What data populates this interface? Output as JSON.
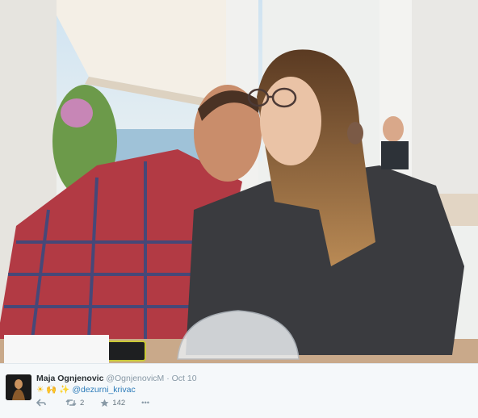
{
  "photo": {
    "alt_icon": "photo-of-couple"
  },
  "tweet": {
    "display_name": "Maja Ognjenovic",
    "handle": "@OgnjenovicM",
    "separator": "·",
    "date": "Oct 10",
    "emoji_sun": "☀",
    "emoji_hands": "🙌",
    "emoji_sparkle": "✨",
    "mention": "@dezurni_krivac",
    "retweet_count": "2",
    "favorite_count": "142",
    "more_label": "•••"
  },
  "colors": {
    "link": "#2b7bb9",
    "meta": "#8899a6",
    "text": "#292f33",
    "footer_bg": "#f5f8fa"
  }
}
